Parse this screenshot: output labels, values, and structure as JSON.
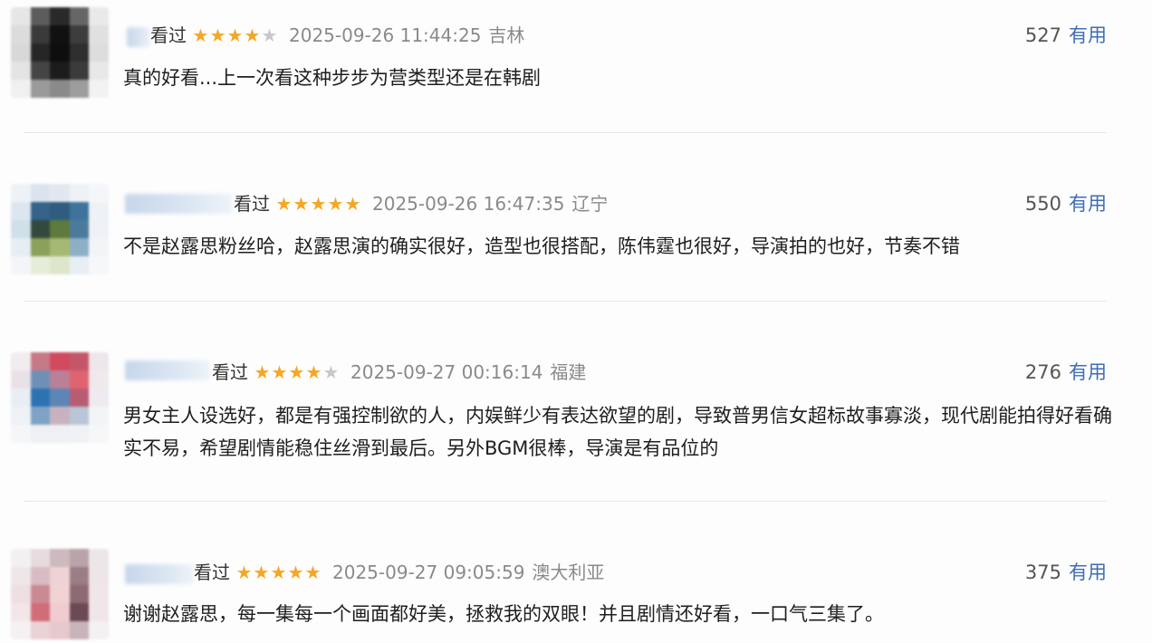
{
  "reviews": [
    {
      "watched": "看过",
      "rating": 4,
      "time": "2025-09-26 11:44:25",
      "location": "吉林",
      "useful_count": "527",
      "useful_label": "有用",
      "content": "真的好看...上一次看这种步步为营类型还是在韩剧",
      "avatar_colors": [
        "#e6e6e6",
        "#5c5c5c",
        "#2a2a2a",
        "#666",
        "#e9e9e9",
        "#dcdcdc",
        "#3a3a3a",
        "#111",
        "#3d3d3d",
        "#e0e0e0",
        "#d8d8d8",
        "#262626",
        "#0e0e0e",
        "#2f2f2f",
        "#dddddd",
        "#e4e4e4",
        "#454545",
        "#1c1c1c",
        "#3b3b3b",
        "#e8e8e8",
        "#f0f0f0",
        "#9a9a9a",
        "#8a8a8a",
        "#9d9d9d",
        "#f2f2f2"
      ]
    },
    {
      "watched": "看过",
      "rating": 5,
      "time": "2025-09-26 16:47:35",
      "location": "辽宁",
      "useful_count": "550",
      "useful_label": "有用",
      "content": "不是赵露思粉丝哈，赵露思演的确实很好，造型也很搭配，陈伟霆也很好，导演拍的也好，节奏不错",
      "avatar_colors": [
        "#eef2f7",
        "#dbe4ee",
        "#e2e8ef",
        "#eef2f6",
        "#f4f6f9",
        "#dde6ef",
        "#35638a",
        "#2f5c7f",
        "#3f739c",
        "#eef2f6",
        "#cfe0e8",
        "#314a3c",
        "#5e7a3c",
        "#4c7a9c",
        "#eef2f6",
        "#e7eef3",
        "#8ba15a",
        "#a7b873",
        "#8eb0c7",
        "#f2f5f8",
        "#f3f5f8",
        "#e5ecd8",
        "#dde6cc",
        "#e8eef3",
        "#f6f7f9"
      ]
    },
    {
      "watched": "看过",
      "rating": 4,
      "time": "2025-09-27 00:16:14",
      "location": "福建",
      "useful_count": "276",
      "useful_label": "有用",
      "content": "男女主人设选好，都是有强控制欲的人，内娱鲜少有表达欲望的剧，导致普男信女超标故事寡淡，现代剧能拍得好看确实不易，希望剧情能稳住丝滑到最后。另外BGM很棒，导演是有品位的",
      "avatar_colors": [
        "#f1ecef",
        "#c77a86",
        "#d24a5e",
        "#c5566a",
        "#eee6ea",
        "#e8e2e7",
        "#6f8fb7",
        "#b98098",
        "#e0646f",
        "#efe9ec",
        "#e9eef5",
        "#2d73b3",
        "#5c86b6",
        "#b95c73",
        "#eeeaf0",
        "#eef1f6",
        "#7ea3c5",
        "#c9b2c0",
        "#b9c6d6",
        "#f3f4f7",
        "#f5f6f8",
        "#eef0f4",
        "#eef0f4",
        "#eff1f5",
        "#f7f7f9"
      ]
    },
    {
      "watched": "看过",
      "rating": 5,
      "time": "2025-09-27 09:05:59",
      "location": "澳大利亚",
      "useful_count": "375",
      "useful_label": "有用",
      "content": "谢谢赵露思，每一集每一个画面都好美，拯救我的双眼！并且剧情还好看，一口气三集了。",
      "avatar_colors": [
        "#f3f0f1",
        "#e6dcdf",
        "#cdb9be",
        "#b9a4aa",
        "#ece6e8",
        "#eee6e8",
        "#d9bcc3",
        "#efd2d4",
        "#9b7d85",
        "#eee5e7",
        "#eedfe2",
        "#c98a94",
        "#f2d3d3",
        "#8f6a72",
        "#f0e6e8",
        "#f2e6e8",
        "#d16d78",
        "#f0ccd0",
        "#6b4a55",
        "#f0e6e9",
        "#f5f0f2",
        "#ead2d6",
        "#e7c8cd",
        "#c9b3bb",
        "#f5f0f2"
      ]
    }
  ]
}
